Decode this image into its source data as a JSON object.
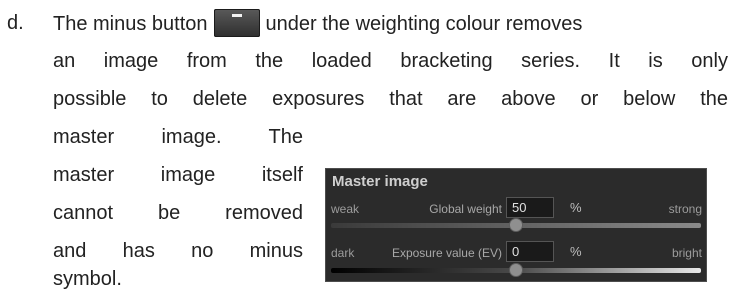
{
  "document": {
    "item_marker": "d.",
    "line1_before_icon": "The minus button",
    "line1_after_icon": "under the weighting colour removes",
    "line2": "an image from the loaded bracketing series. It is only",
    "line3": "possible to delete exposures that are above or below the",
    "line4": "master image. The",
    "line5": "master image itself",
    "line6": "cannot be removed",
    "line7": "and has no minus",
    "line8": "symbol.",
    "minus_icon": "minus-icon"
  },
  "panel": {
    "title": "Master image",
    "weight_row": {
      "left_label": "weak",
      "label": "Global weight",
      "value": "50",
      "unit": "%",
      "right_label": "strong",
      "slider_level": 0.5
    },
    "exposure_row": {
      "left_label": "dark",
      "label": "Exposure value (EV)",
      "value": "0",
      "unit": "%",
      "right_label": "bright",
      "slider_level": 0.5
    }
  }
}
